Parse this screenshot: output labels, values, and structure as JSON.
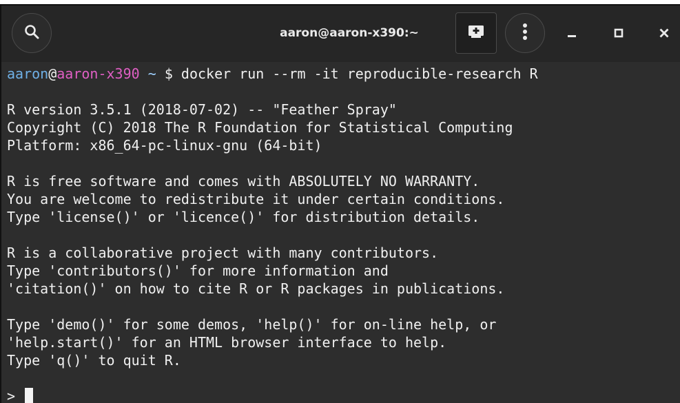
{
  "window": {
    "title": "aaron@aaron-x390:~"
  },
  "titlebar": {
    "icons": [
      "search-icon",
      "new-tab-icon",
      "menu-icon",
      "minimize-icon",
      "maximize-icon",
      "close-icon"
    ]
  },
  "colors": {
    "background": "#2d2d2d",
    "titlebar": "#262626",
    "text": "#f0f0f0",
    "user": "#6fb0e6",
    "host": "#e05fc4"
  },
  "terminal": {
    "prompt": {
      "user": "aaron",
      "at": "@",
      "host": "aaron-x390",
      "path": " ~",
      "symbol": " $ ",
      "command": "docker run --rm -it reproducible-research R"
    },
    "output": [
      "",
      "R version 3.5.1 (2018-07-02) -- \"Feather Spray\"",
      "Copyright (C) 2018 The R Foundation for Statistical Computing",
      "Platform: x86_64-pc-linux-gnu (64-bit)",
      "",
      "R is free software and comes with ABSOLUTELY NO WARRANTY.",
      "You are welcome to redistribute it under certain conditions.",
      "Type 'license()' or 'licence()' for distribution details.",
      "",
      "R is a collaborative project with many contributors.",
      "Type 'contributors()' for more information and",
      "'citation()' on how to cite R or R packages in publications.",
      "",
      "Type 'demo()' for some demos, 'help()' for on-line help, or",
      "'help.start()' for an HTML browser interface to help.",
      "Type 'q()' to quit R.",
      ""
    ],
    "r_prompt": "> "
  }
}
